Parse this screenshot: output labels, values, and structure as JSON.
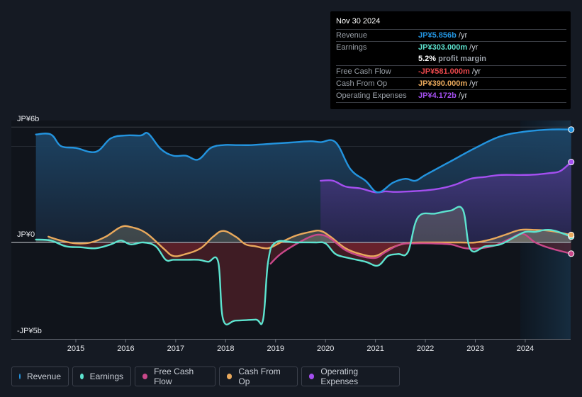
{
  "tooltip": {
    "date": "Nov 30 2024",
    "rows": [
      {
        "label": "Revenue",
        "value": "JP¥5.856b",
        "suffix": " /yr",
        "color": "#2394df"
      },
      {
        "label": "Earnings",
        "value": "JP¥303.000m",
        "suffix": " /yr",
        "color": "#5de3cf"
      },
      {
        "label": "",
        "value": "5.2%",
        "suffix": " profit margin",
        "color": "#ffffff"
      },
      {
        "label": "Free Cash Flow",
        "value": "-JP¥581.000m",
        "suffix": " /yr",
        "color": "#e8474b"
      },
      {
        "label": "Cash From Op",
        "value": "JP¥390.000m",
        "suffix": " /yr",
        "color": "#e9a95c"
      },
      {
        "label": "Operating Expenses",
        "value": "JP¥4.172b",
        "suffix": " /yr",
        "color": "#a44ff0"
      }
    ]
  },
  "legend": [
    {
      "label": "Revenue",
      "color": "#2394df"
    },
    {
      "label": "Earnings",
      "color": "#5de3cf"
    },
    {
      "label": "Free Cash Flow",
      "color": "#c9488a"
    },
    {
      "label": "Cash From Op",
      "color": "#e9a95c"
    },
    {
      "label": "Operating Expenses",
      "color": "#a44ff0"
    }
  ],
  "chart_data": {
    "type": "area",
    "title": "",
    "xlabel": "",
    "ylabel": "",
    "y_tick_labels": [
      "JP¥6b",
      "JP¥0",
      "-JP¥5b"
    ],
    "y_ticks": [
      6,
      0,
      -5
    ],
    "ylim": [
      -5,
      6
    ],
    "xlim": [
      2014.2,
      2024.92
    ],
    "x_tick_labels": [
      "2015",
      "2016",
      "2017",
      "2018",
      "2019",
      "2020",
      "2021",
      "2022",
      "2023",
      "2024"
    ],
    "x_ticks": [
      2015,
      2016,
      2017,
      2018,
      2019,
      2020,
      2021,
      2022,
      2023,
      2024
    ],
    "units": "JP¥ billions",
    "grid": true,
    "forecast_shade_start": 2023.9,
    "series": [
      {
        "name": "Revenue",
        "color": "#2394df",
        "x": [
          2014.2,
          2014.5,
          2014.7,
          2015.0,
          2015.4,
          2015.7,
          2016.0,
          2016.3,
          2016.45,
          2016.7,
          2016.95,
          2017.2,
          2017.45,
          2017.7,
          2017.95,
          2018.2,
          2018.5,
          2018.8,
          2019.1,
          2019.4,
          2019.7,
          2019.9,
          2020.2,
          2020.5,
          2020.8,
          2021.05,
          2021.35,
          2021.6,
          2021.8,
          2022.0,
          2022.5,
          2023.0,
          2023.5,
          2024.0,
          2024.5,
          2024.92
        ],
        "values": [
          5.6,
          5.6,
          5.0,
          4.9,
          4.7,
          5.4,
          5.55,
          5.55,
          5.65,
          4.85,
          4.5,
          4.5,
          4.3,
          4.9,
          5.05,
          5.05,
          5.05,
          5.1,
          5.15,
          5.2,
          5.25,
          5.2,
          5.2,
          3.8,
          3.2,
          2.6,
          3.1,
          3.3,
          3.2,
          3.5,
          4.2,
          4.9,
          5.5,
          5.75,
          5.856,
          5.856
        ]
      },
      {
        "name": "Earnings",
        "color": "#5de3cf",
        "x": [
          2014.2,
          2014.5,
          2014.8,
          2015.1,
          2015.4,
          2015.7,
          2015.9,
          2016.1,
          2016.35,
          2016.6,
          2016.8,
          2016.95,
          2017.2,
          2017.45,
          2017.65,
          2017.85,
          2017.95,
          2018.2,
          2018.6,
          2018.75,
          2018.85,
          2019.0,
          2019.4,
          2019.8,
          2020.0,
          2020.2,
          2020.45,
          2020.8,
          2021.05,
          2021.25,
          2021.45,
          2021.65,
          2021.85,
          2022.2,
          2022.5,
          2022.75,
          2022.9,
          2023.2,
          2023.5,
          2023.8,
          2024.0,
          2024.2,
          2024.4,
          2024.6,
          2024.92
        ],
        "values": [
          0.15,
          0.1,
          -0.2,
          -0.25,
          -0.3,
          -0.1,
          0.1,
          -0.1,
          0.0,
          -0.2,
          -0.9,
          -0.9,
          -0.9,
          -0.9,
          -1.0,
          -1.0,
          -4.0,
          -4.05,
          -4.0,
          -4.0,
          -1.0,
          0.0,
          0.0,
          0.0,
          -0.05,
          -0.6,
          -0.8,
          -1.0,
          -1.2,
          -0.7,
          -0.6,
          -0.5,
          1.3,
          1.5,
          1.65,
          1.7,
          -0.35,
          -0.2,
          -0.1,
          0.3,
          0.55,
          0.55,
          0.65,
          0.6,
          0.303
        ]
      },
      {
        "name": "Free Cash Flow",
        "color": "#c9488a",
        "x": [
          2018.9,
          2019.1,
          2019.4,
          2019.7,
          2019.9,
          2020.1,
          2020.4,
          2020.7,
          2021.0,
          2021.2,
          2021.5,
          2021.8,
          2022.1,
          2022.5,
          2022.8,
          2023.1,
          2023.4,
          2023.7,
          2023.95,
          2024.2,
          2024.5,
          2024.92
        ],
        "values": [
          -1.1,
          -0.6,
          -0.1,
          0.3,
          0.4,
          0.2,
          -0.4,
          -0.7,
          -0.8,
          -0.5,
          -0.1,
          -0.05,
          -0.05,
          -0.1,
          -0.3,
          -0.3,
          -0.15,
          0.2,
          0.45,
          0.0,
          -0.3,
          -0.581
        ]
      },
      {
        "name": "Cash From Op",
        "color": "#e9a95c",
        "x": [
          2014.45,
          2014.7,
          2015.0,
          2015.3,
          2015.6,
          2015.9,
          2016.1,
          2016.4,
          2016.75,
          2016.95,
          2017.2,
          2017.5,
          2017.75,
          2017.95,
          2018.2,
          2018.4,
          2018.6,
          2018.85,
          2019.1,
          2019.4,
          2019.7,
          2019.9,
          2020.1,
          2020.4,
          2020.7,
          2021.0,
          2021.3,
          2021.6,
          2021.9,
          2022.3,
          2022.7,
          2023.0,
          2023.3,
          2023.6,
          2023.9,
          2024.2,
          2024.5,
          2024.92
        ],
        "values": [
          0.3,
          0.1,
          -0.05,
          0.0,
          0.3,
          0.8,
          0.8,
          0.5,
          -0.3,
          -0.7,
          -0.6,
          -0.3,
          0.3,
          0.6,
          0.3,
          -0.1,
          -0.2,
          -0.3,
          0.0,
          0.35,
          0.55,
          0.6,
          0.3,
          -0.3,
          -0.6,
          -0.7,
          -0.3,
          -0.05,
          0.0,
          0.0,
          0.0,
          0.0,
          0.15,
          0.4,
          0.65,
          0.65,
          0.6,
          0.39
        ]
      },
      {
        "name": "Operating Expenses",
        "color": "#a44ff0",
        "x": [
          2019.9,
          2020.15,
          2020.4,
          2020.7,
          2021.0,
          2021.2,
          2021.4,
          2021.7,
          2022.0,
          2022.3,
          2022.6,
          2022.9,
          2023.2,
          2023.5,
          2023.9,
          2024.2,
          2024.5,
          2024.7,
          2024.92
        ],
        "values": [
          3.2,
          3.2,
          2.9,
          2.8,
          2.6,
          2.65,
          2.62,
          2.65,
          2.7,
          2.8,
          3.0,
          3.3,
          3.4,
          3.5,
          3.5,
          3.52,
          3.6,
          3.7,
          4.172
        ]
      }
    ]
  }
}
